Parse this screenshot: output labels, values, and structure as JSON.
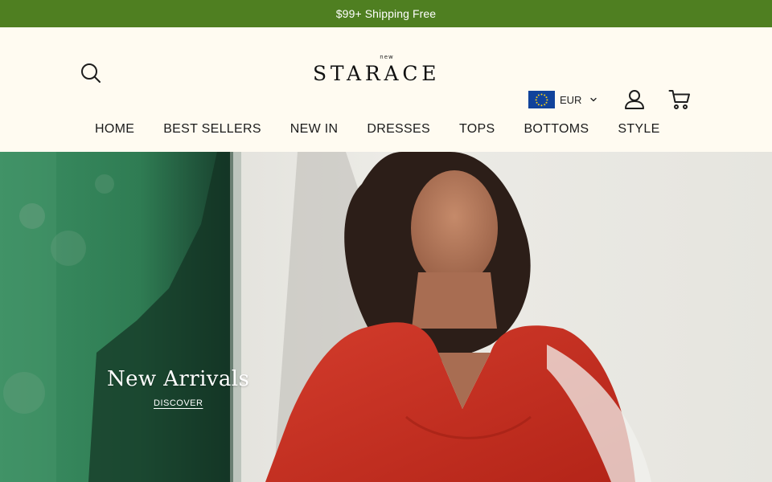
{
  "announcement": {
    "text": "$99+ Shipping Free"
  },
  "header": {
    "logo_small": "new",
    "logo_text": "STARACE",
    "currency": {
      "code": "EUR"
    }
  },
  "nav": {
    "items": [
      {
        "label": "HOME"
      },
      {
        "label": "BEST SELLERS"
      },
      {
        "label": "NEW IN"
      },
      {
        "label": "DRESSES"
      },
      {
        "label": "TOPS"
      },
      {
        "label": "BOTTOMS"
      },
      {
        "label": "STYLE"
      }
    ]
  },
  "hero": {
    "title": "New Arrivals",
    "cta": "DISCOVER"
  },
  "colors": {
    "announcement_bg": "#4f7f21",
    "page_bg": "#fffbf1",
    "text": "#1d1d1d"
  },
  "icons": {
    "search": "search-icon",
    "account": "user-icon",
    "cart": "shopping-cart-icon",
    "currency_dropdown": "chevron-down-icon",
    "currency_flag": "eu-flag-icon"
  }
}
